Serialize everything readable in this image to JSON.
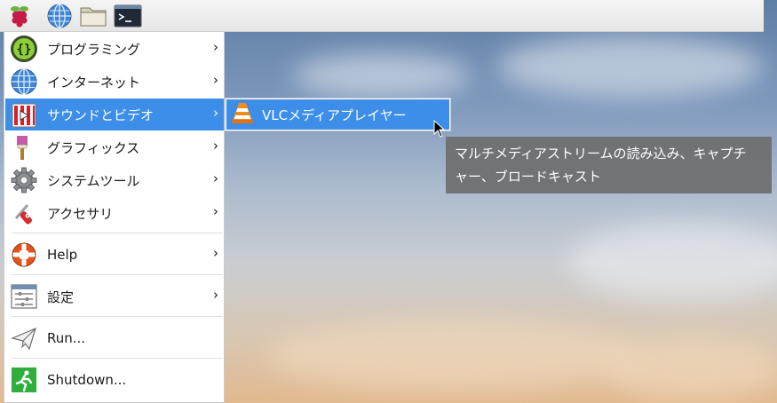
{
  "taskbar": {
    "buttons": [
      {
        "name": "raspberry-menu-button",
        "icon": "raspberry-icon"
      },
      {
        "name": "web-browser-button",
        "icon": "globe-icon"
      },
      {
        "name": "file-manager-button",
        "icon": "folder-icon"
      },
      {
        "name": "terminal-button",
        "icon": "terminal-icon",
        "glyph": ">_"
      }
    ]
  },
  "menu": {
    "items": [
      {
        "label": "プログラミング",
        "icon": "programming-icon",
        "has_submenu": true,
        "arrow": "›"
      },
      {
        "label": "インターネット",
        "icon": "globe-icon",
        "has_submenu": true,
        "arrow": "›"
      },
      {
        "label": "サウンドとビデオ",
        "icon": "sound-video-icon",
        "has_submenu": true,
        "selected": true,
        "arrow": "›"
      },
      {
        "label": "グラフィックス",
        "icon": "graphics-icon",
        "has_submenu": true,
        "arrow": "›"
      },
      {
        "label": "システムツール",
        "icon": "gear-icon",
        "has_submenu": true,
        "arrow": "›"
      },
      {
        "label": "アクセサリ",
        "icon": "accessories-icon",
        "has_submenu": true,
        "arrow": "›"
      },
      {
        "label": "Help",
        "icon": "lifebuoy-icon",
        "has_submenu": true,
        "arrow": "›"
      },
      {
        "label": "設定",
        "icon": "settings-icon",
        "has_submenu": true,
        "arrow": "›"
      },
      {
        "label": "Run...",
        "icon": "paper-plane-icon",
        "has_submenu": false
      },
      {
        "label": "Shutdown...",
        "icon": "exit-icon",
        "has_submenu": false
      }
    ]
  },
  "submenu": {
    "items": [
      {
        "label": "VLCメディアプレイヤー",
        "icon": "vlc-cone-icon",
        "selected": true
      }
    ]
  },
  "tooltip": {
    "line1": "マルチメディアストリームの読み込み、キャプチ",
    "line2": "ャー、ブロードキャスト"
  },
  "colors": {
    "selection": "#3c8ee8",
    "tooltip_bg": "#6e6e6e"
  }
}
